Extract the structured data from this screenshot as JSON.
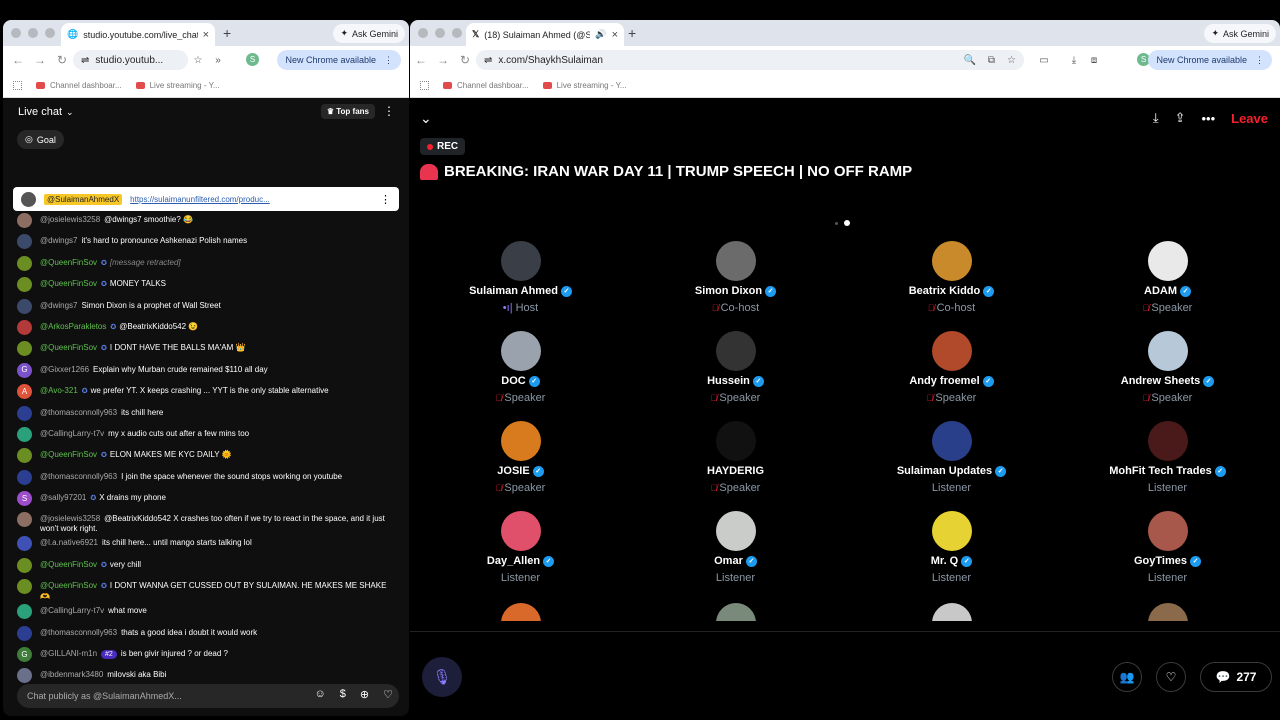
{
  "left": {
    "tab_title": "studio.youtube.com/live_chat",
    "gemini": "Ask Gemini",
    "url": "studio.youtub...",
    "new_chrome": "New Chrome available",
    "bookmarks": [
      "Channel dashboar...",
      "Live streaming - Y..."
    ],
    "chat_title": "Live chat",
    "top_fans": "Top fans",
    "goal": "Goal",
    "pinned_user": "@SulaimanAhmedX",
    "pinned_link": "https://sulaimanunfiltered.com/produc...",
    "messages": [
      {
        "user": "@josielewis3258",
        "text": "@dwings7 smoothie? 😂",
        "color": "#8d6e63",
        "init": "",
        "mod": false,
        "badge": false,
        "rank": ""
      },
      {
        "user": "@dwings7",
        "text": "it's hard to pronounce Ashkenazi Polish names",
        "color": "#3b4a6b",
        "init": "",
        "mod": false,
        "badge": false,
        "rank": ""
      },
      {
        "user": "@QueenFinSov",
        "text": "[message retracted]",
        "color": "#6b8e23",
        "init": "",
        "mod": true,
        "badge": true,
        "rank": "",
        "retracted": true
      },
      {
        "user": "@QueenFinSov",
        "text": "MONEY TALKS",
        "color": "#6b8e23",
        "init": "",
        "mod": true,
        "badge": true,
        "rank": ""
      },
      {
        "user": "@dwings7",
        "text": "Simon Dixon is a prophet of Wall Street",
        "color": "#3b4a6b",
        "init": "",
        "mod": false,
        "badge": false,
        "rank": ""
      },
      {
        "user": "@ArkosParakletos",
        "text": "@BeatrixKiddo542 😉",
        "color": "#b33a3a",
        "init": "",
        "mod": true,
        "badge": true,
        "rank": ""
      },
      {
        "user": "@QueenFinSov",
        "text": "I DONT HAVE THE BALLS MA'AM 👑",
        "color": "#6b8e23",
        "init": "",
        "mod": true,
        "badge": true,
        "rank": ""
      },
      {
        "user": "@Gixxer1266",
        "text": "Explain why Murban crude remained $110 all day",
        "color": "#7b52c9",
        "init": "G",
        "mod": false,
        "badge": false,
        "rank": ""
      },
      {
        "user": "@Avo-321",
        "text": "we prefer YT. X keeps crashing ... YYT is the only stable alternative",
        "color": "#e0533b",
        "init": "A",
        "mod": true,
        "badge": true,
        "rank": ""
      },
      {
        "user": "@thomasconnolly963",
        "text": "its chill here",
        "color": "#2c3e91",
        "init": "",
        "mod": false,
        "badge": false,
        "rank": ""
      },
      {
        "user": "@CallingLarry-t7v",
        "text": "my x audio cuts out after a few mins too",
        "color": "#2aa17a",
        "init": "",
        "mod": false,
        "badge": false,
        "rank": ""
      },
      {
        "user": "@QueenFinSov",
        "text": "ELON MAKES ME KYC DAILY 🌞",
        "color": "#6b8e23",
        "init": "",
        "mod": true,
        "badge": true,
        "rank": ""
      },
      {
        "user": "@thomasconnolly963",
        "text": "I join the space whenever the sound stops working on youtube",
        "color": "#2c3e91",
        "init": "",
        "mod": false,
        "badge": false,
        "rank": ""
      },
      {
        "user": "@sally97201",
        "text": "X drains my phone",
        "color": "#9c4dcc",
        "init": "S",
        "mod": false,
        "badge": true,
        "rank": ""
      },
      {
        "user": "@josielewis3258",
        "text": "@BeatrixKiddo542 X crashes too often if we try to react in the space, and it just won't work right.",
        "color": "#8d6e63",
        "init": "",
        "mod": false,
        "badge": false,
        "rank": ""
      },
      {
        "user": "@l.a.native6921",
        "text": "its chill here... until mango starts talking lol",
        "color": "#3f51b5",
        "init": "",
        "mod": false,
        "badge": false,
        "rank": ""
      },
      {
        "user": "@QueenFinSov",
        "text": "very chill",
        "color": "#6b8e23",
        "init": "",
        "mod": true,
        "badge": true,
        "rank": ""
      },
      {
        "user": "@QueenFinSov",
        "text": "I DONT WANNA GET CUSSED OUT BY SULAIMAN. HE MAKES ME SHAKE🫶",
        "color": "#6b8e23",
        "init": "",
        "mod": true,
        "badge": true,
        "rank": ""
      },
      {
        "user": "@CallingLarry-t7v",
        "text": "what move",
        "color": "#2aa17a",
        "init": "",
        "mod": false,
        "badge": false,
        "rank": ""
      },
      {
        "user": "@thomasconnolly963",
        "text": "thats a good idea i doubt it would work",
        "color": "#2c3e91",
        "init": "",
        "mod": false,
        "badge": false,
        "rank": ""
      },
      {
        "user": "@GILLANI-m1n",
        "text": "is ben givir injured ? or dead ?",
        "color": "#3e7d3a",
        "init": "G",
        "mod": false,
        "badge": false,
        "rank": "#2"
      },
      {
        "user": "@ibdenmark3480",
        "text": "milovski aka Bibi",
        "color": "#6a6f8a",
        "init": "",
        "mod": false,
        "badge": false,
        "rank": ""
      }
    ],
    "chat_placeholder": "Chat publicly as @SulaimanAhmedX..."
  },
  "right": {
    "tab_title": "(18) Sulaiman Ahmed (@S...",
    "gemini": "Ask Gemini",
    "url": "x.com/ShaykhSulaiman",
    "new_chrome": "New Chrome available",
    "bookmarks": [
      "Channel dashboar...",
      "Live streaming - Y..."
    ],
    "leave": "Leave",
    "rec": "REC",
    "title": "BREAKING: IRAN WAR DAY 11 | TRUMP SPEECH | NO OFF RAMP",
    "participants": [
      {
        "name": "Sulaiman Ahmed",
        "role": "Host",
        "verified": true,
        "color": "#3a3f47",
        "mic": false,
        "host": true
      },
      {
        "name": "Simon Dixon",
        "role": "Co-host",
        "verified": true,
        "color": "#6b6b6b",
        "mic": true,
        "host": false
      },
      {
        "name": "Beatrix Kiddo",
        "role": "Co-host",
        "verified": true,
        "color": "#c88a2a",
        "mic": true,
        "host": false
      },
      {
        "name": "ADAM",
        "role": "Speaker",
        "verified": true,
        "color": "#e9e9e9",
        "mic": true,
        "host": false
      },
      {
        "name": "DOC",
        "role": "Speaker",
        "verified": true,
        "color": "#9aa3ad",
        "mic": true,
        "host": false
      },
      {
        "name": "Hussein",
        "role": "Speaker",
        "verified": true,
        "color": "#333333",
        "mic": true,
        "host": false
      },
      {
        "name": "Andy froemel",
        "role": "Speaker",
        "verified": true,
        "color": "#b04a2a",
        "mic": true,
        "host": false
      },
      {
        "name": "Andrew Sheets",
        "role": "Speaker",
        "verified": true,
        "color": "#b7c9d8",
        "mic": true,
        "host": false
      },
      {
        "name": "JOSIE",
        "role": "Speaker",
        "verified": true,
        "color": "#d87a1e",
        "mic": true,
        "host": false
      },
      {
        "name": "HAYDERIG",
        "role": "Speaker",
        "verified": false,
        "color": "#111111",
        "mic": true,
        "host": false
      },
      {
        "name": "Sulaiman Updates",
        "role": "Listener",
        "verified": true,
        "color": "#2a3f8a",
        "mic": false,
        "host": false
      },
      {
        "name": "MohFit Tech Trades",
        "role": "Listener",
        "verified": true,
        "color": "#4a1a1a",
        "mic": false,
        "host": false
      },
      {
        "name": "Day_Allen",
        "role": "Listener",
        "verified": true,
        "color": "#e0506a",
        "mic": false,
        "host": false
      },
      {
        "name": "Omar",
        "role": "Listener",
        "verified": true,
        "color": "#c9ccc8",
        "mic": false,
        "host": false
      },
      {
        "name": "Mr. Q",
        "role": "Listener",
        "verified": true,
        "color": "#e7d233",
        "mic": false,
        "host": false
      },
      {
        "name": "GoyTimes",
        "role": "Listener",
        "verified": true,
        "color": "#a8584a",
        "mic": false,
        "host": false
      }
    ],
    "reply_count": "277"
  },
  "colors": {
    "accent_red": "#f4212e",
    "verified_blue": "#1d9bf0",
    "mod_green": "#5ec14e"
  }
}
